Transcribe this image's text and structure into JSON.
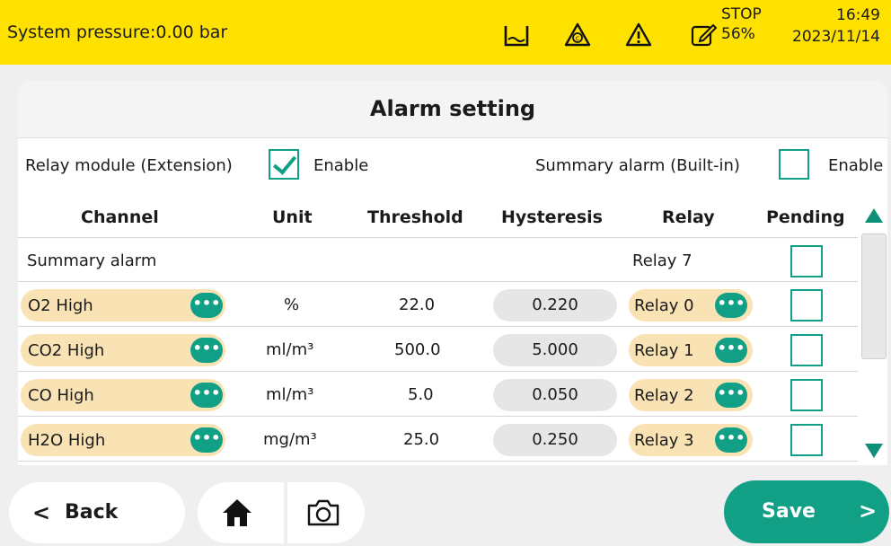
{
  "status_bar": {
    "pressure_text": "System pressure:0.00 bar",
    "icons": [
      "tank-icon",
      "calibration-icon",
      "warning-icon",
      "edit-icon"
    ],
    "run_state": "STOP",
    "run_percent": "56%",
    "time": "16:49",
    "date": "2023/11/14",
    "background_color": "#ffe100"
  },
  "page": {
    "title": "Alarm setting"
  },
  "options": {
    "relay_module_label": "Relay module (Extension)",
    "relay_module_enabled": true,
    "relay_enable_label": "Enable",
    "summary_alarm_label": "Summary alarm (Built-in)",
    "summary_alarm_enabled": false,
    "summary_enable_label": "Enable"
  },
  "table": {
    "headers": {
      "channel": "Channel",
      "unit": "Unit",
      "threshold": "Threshold",
      "hysteresis": "Hysteresis",
      "relay": "Relay",
      "pending": "Pending"
    },
    "summary_row": {
      "channel": "Summary alarm",
      "relay": "Relay 7"
    },
    "rows": [
      {
        "channel": "O2 High",
        "unit": "%",
        "threshold": "22.0",
        "hysteresis": "0.220",
        "relay": "Relay 0"
      },
      {
        "channel": "CO2 High",
        "unit": "ml/m³",
        "threshold": "500.0",
        "hysteresis": "5.000",
        "relay": "Relay 1"
      },
      {
        "channel": "CO High",
        "unit": "ml/m³",
        "threshold": "5.0",
        "hysteresis": "0.050",
        "relay": "Relay 2"
      },
      {
        "channel": "H2O High",
        "unit": "mg/m³",
        "threshold": "25.0",
        "hysteresis": "0.250",
        "relay": "Relay 3"
      }
    ],
    "more_button": "•••"
  },
  "bottom": {
    "back_label": "Back",
    "save_label": "Save",
    "back_chevron": "<",
    "save_chevron": ">"
  },
  "colors": {
    "accent": "#11a086",
    "channel_pill": "#f9e3b4",
    "hysteresis_pill": "#e6e6e6"
  }
}
